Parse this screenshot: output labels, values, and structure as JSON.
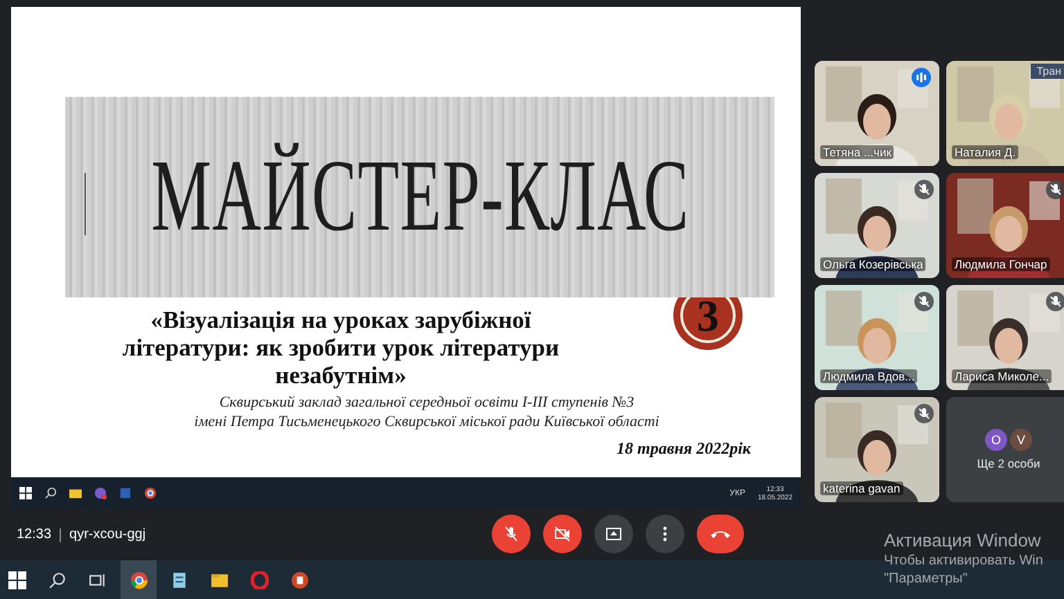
{
  "slide": {
    "title": "МАЙСТЕР-КЛАС",
    "quote_lines": [
      "«Візуалізація на уроках зарубіжної",
      "літератури: як зробити урок літератури",
      "незабутнім»"
    ],
    "badge": "3",
    "subtitle_lines": [
      "Сквирський заклад загальної середньої освіти І-ІІІ ступенів №3",
      "імені Петра Тисьменецького Сквирської міської ради Київської області"
    ],
    "date": "18 травня 2022рік"
  },
  "shared_taskbar": {
    "language": "УКР",
    "time": "12:33",
    "date": "18.05.2022"
  },
  "top_right_label": "Тран",
  "participants": [
    {
      "kind": "video",
      "name": "Тетяна ...чик",
      "muted": false,
      "speaking": true
    },
    {
      "kind": "video",
      "name": "Наталия Д.",
      "muted": false,
      "speaking": false
    },
    {
      "kind": "video",
      "name": "Ольга Козерівська",
      "muted": true,
      "speaking": false
    },
    {
      "kind": "video",
      "name": "Людмила Гончар",
      "muted": true,
      "speaking": false
    },
    {
      "kind": "video",
      "name": "Людмила Вдов...",
      "muted": true,
      "speaking": false
    },
    {
      "kind": "video",
      "name": "Лариса Миколе...",
      "muted": true,
      "speaking": false
    },
    {
      "kind": "video",
      "name": "katerina gavan",
      "muted": true,
      "speaking": false
    },
    {
      "kind": "more",
      "avatars": [
        {
          "letter": "О",
          "color": "#7e57c2"
        },
        {
          "letter": "V",
          "color": "#6d4c41"
        }
      ],
      "label": "Ще 2 особи"
    }
  ],
  "meeting": {
    "time": "12:33",
    "code": "qyr-xcou-ggj",
    "mic_on": false,
    "camera_on": false
  },
  "activation": {
    "title": "Активация Window",
    "line": "Чтобы активировать Win",
    "link": "\"Параметры\""
  }
}
